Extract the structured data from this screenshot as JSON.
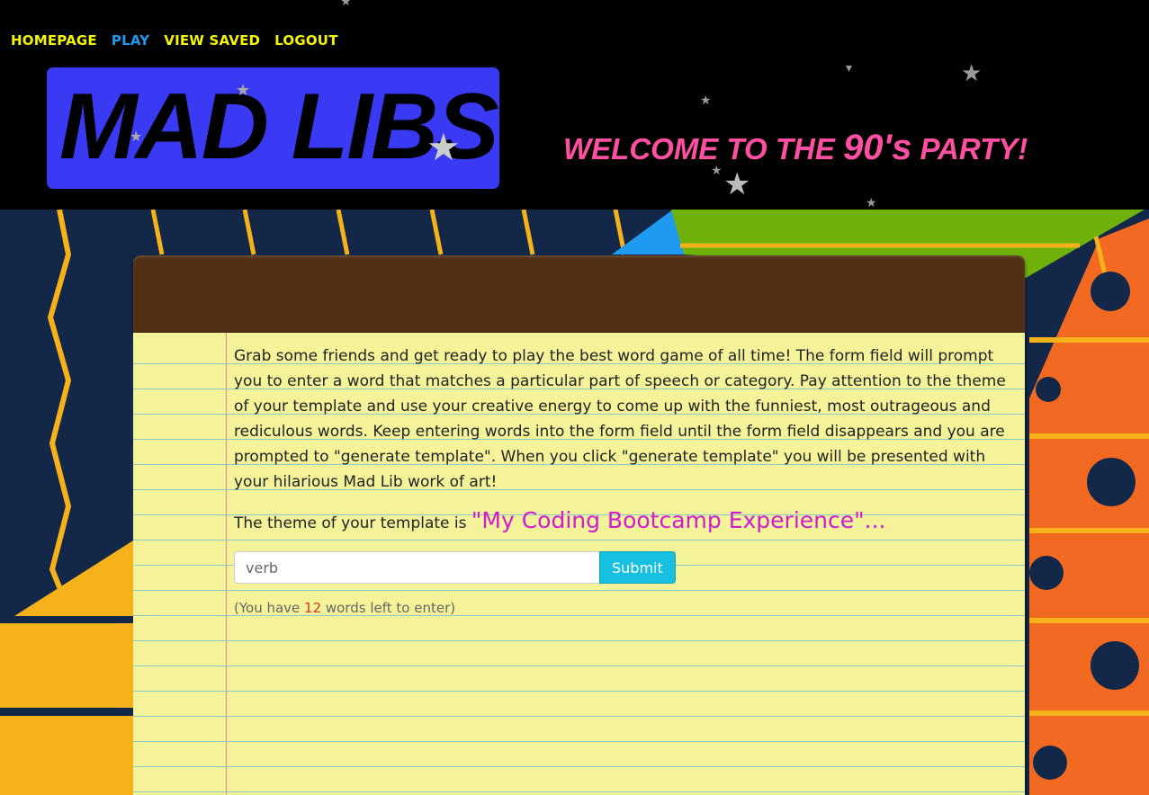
{
  "nav": {
    "items": [
      {
        "label": "HOMEPAGE",
        "active": false
      },
      {
        "label": "PLAY",
        "active": true
      },
      {
        "label": "VIEW SAVED",
        "active": false
      },
      {
        "label": "LOGOUT",
        "active": false
      }
    ]
  },
  "logo": {
    "text": "MAD LIBS"
  },
  "welcome": {
    "before": "WELCOME TO THE ",
    "highlight": "90's",
    "after": " PARTY!"
  },
  "game": {
    "instructions": "Grab some friends and get ready to play the best word game of all time! The form field will prompt you to enter a word that matches a particular part of speech or category. Pay attention to the theme of your template and use your creative energy to come up with the funniest, most outrageous and rediculous words. Keep entering words into the form field until the form field disappears and you are prompted to \"generate template\". When you click \"generate template\" you will be presented with your hilarious Mad Lib work of art!",
    "theme_prefix": "The theme of your template is ",
    "theme_value": "\"My Coding Bootcamp Experience\"...",
    "input_placeholder": "verb",
    "submit_label": "Submit",
    "counter_prefix": "(You have ",
    "counter_value": "12",
    "counter_suffix": " words left to enter)"
  },
  "colors": {
    "nav_text": "#f5f500",
    "nav_active": "#1e9bf0",
    "logo_bg": "#3a3af5",
    "welcome_text": "#ff4fa0",
    "theme_text": "#d11bd1",
    "counter_number": "#d0392b",
    "submit_bg": "#17c0e0",
    "paper": "#f5f39a",
    "notepad_top": "#522e14"
  },
  "icons": [
    "star-icon"
  ]
}
